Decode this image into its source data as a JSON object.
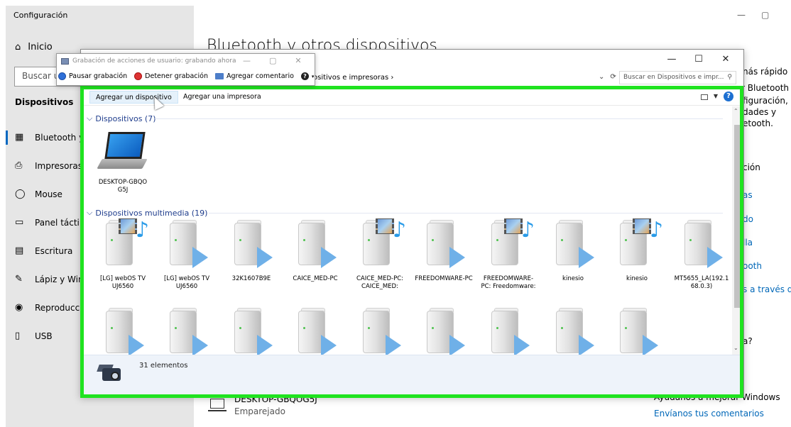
{
  "settings": {
    "window_title": "Configuración",
    "home_label": "Inicio",
    "search_placeholder": "Buscar u",
    "section": "Dispositivos",
    "nav": [
      {
        "label": "Bluetooth y",
        "icon": "bluetooth-icon"
      },
      {
        "label": "Impresoras y",
        "icon": "printer-icon"
      },
      {
        "label": "Mouse",
        "icon": "mouse-icon"
      },
      {
        "label": "Panel táctil",
        "icon": "touchpad-icon"
      },
      {
        "label": "Escritura",
        "icon": "keyboard-icon"
      },
      {
        "label": "Lápiz y Winc",
        "icon": "pen-icon"
      },
      {
        "label": "Reproducció",
        "icon": "autoplay-icon"
      },
      {
        "label": "USB",
        "icon": "usb-icon"
      }
    ],
    "heading": "Bluetooth y otros dispositivos",
    "controls": {
      "minimize": "—",
      "restore": "▢"
    },
    "right_panel": {
      "line1": "nás rápido",
      "line2": "r Bluetooth",
      "line3": "figuración,",
      "line4": "dades y",
      "line5": "etooth.",
      "related": "ción",
      "link1": "as",
      "link2": "do",
      "link3": "lla",
      "link4": "ooth",
      "link5": "s a través de",
      "question": "a?",
      "improve": "Ayúdanos a mejorar Windows",
      "feedback": "Envíanos tus comentarios"
    },
    "paired_device": {
      "name": "DESKTOP-GBQOG5J",
      "status": "Emparejado"
    }
  },
  "steps_recorder": {
    "title": "Grabación de acciones de usuario: grabando ahora",
    "buttons": {
      "minimize": "—",
      "maximize": "▢",
      "close": "✕"
    },
    "pause": "Pausar grabación",
    "stop": "Detener grabación",
    "comment": "Agregar comentario",
    "help": "?"
  },
  "explorer": {
    "buttons": {
      "minimize": "—",
      "maximize": "☐",
      "close": "✕"
    },
    "address": "ositivos e impresoras  ›",
    "refresh": "⟳",
    "dropdown": "⌄",
    "search_placeholder": "Buscar en Dispositivos e impr...",
    "commands": {
      "add_device": "Agregar un dispositivo",
      "add_printer": "Agregar una impresora"
    },
    "help": "?",
    "groups": {
      "devices": "Dispositivos (7)",
      "multimedia": "Dispositivos multimedia (19)"
    },
    "devices": [
      {
        "label": "DESKTOP-GBQO G5J",
        "icon": "laptop-icon"
      }
    ],
    "multimedia_row1": [
      {
        "label": "[LG] webOS TV UJ6560",
        "icon": "media-server-icon",
        "media": true
      },
      {
        "label": "[LG] webOS TV UJ6560",
        "icon": "media-device-icon",
        "media": false
      },
      {
        "label": "32K1607B9E",
        "icon": "media-device-icon",
        "media": false
      },
      {
        "label": "CAICE_MED-PC",
        "icon": "media-device-icon",
        "media": false
      },
      {
        "label": "CAICE_MED-PC: CAICE_MED:",
        "icon": "media-server-icon",
        "media": true
      },
      {
        "label": "FREEDOMWARE-PC",
        "icon": "media-device-icon",
        "media": false
      },
      {
        "label": "FREEDOMWARE-PC: Freedomware:",
        "icon": "media-server-icon",
        "media": true
      },
      {
        "label": "kinesio",
        "icon": "media-device-icon",
        "media": false
      },
      {
        "label": "kinesio",
        "icon": "media-server-icon",
        "media": true
      },
      {
        "label": "MT5655_LA(192.168.0.3)",
        "icon": "media-device-icon",
        "media": false
      }
    ],
    "multimedia_row2_count": 9,
    "status": "31 elementos",
    "scroll": {
      "up": "⌃",
      "down": "⌄"
    }
  },
  "colors": {
    "focus_frame": "#1fe31f",
    "accent": "#0067c0",
    "group_header": "#1e3c8c"
  }
}
